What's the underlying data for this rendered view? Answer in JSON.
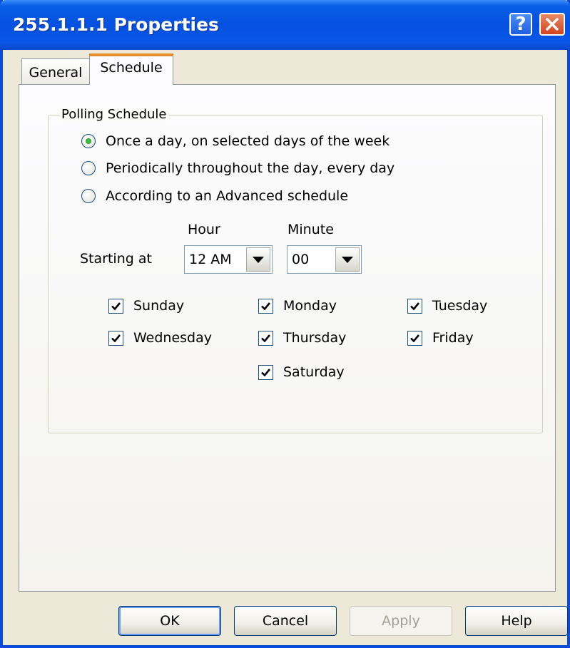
{
  "window": {
    "title": "255.1.1.1 Properties",
    "help_symbol": "?",
    "accent_color": "#0a5ee6"
  },
  "tabs": [
    {
      "label": "General",
      "selected": false
    },
    {
      "label": "Schedule",
      "selected": true
    }
  ],
  "polling_schedule": {
    "legend": "Polling Schedule",
    "options": [
      {
        "label": "Once a day, on selected days of the week",
        "checked": true
      },
      {
        "label": "Periodically throughout the day, every day",
        "checked": false
      },
      {
        "label": "According to an Advanced schedule",
        "checked": false
      }
    ],
    "hour_label": "Hour",
    "minute_label": "Minute",
    "starting_at_label": "Starting at",
    "hour_value": "12 AM",
    "minute_value": "00",
    "days": [
      {
        "label": "Sunday",
        "checked": true
      },
      {
        "label": "Monday",
        "checked": true
      },
      {
        "label": "Tuesday",
        "checked": true
      },
      {
        "label": "Wednesday",
        "checked": true
      },
      {
        "label": "Thursday",
        "checked": true
      },
      {
        "label": "Friday",
        "checked": true
      },
      {
        "label": "Saturday",
        "checked": true
      }
    ]
  },
  "buttons": {
    "ok": "OK",
    "cancel": "Cancel",
    "apply": "Apply",
    "help": "Help"
  },
  "icons": {
    "help": "help-icon",
    "close": "close-icon",
    "dropdown": "chevron-down-icon",
    "checkmark": "checkmark-icon"
  }
}
